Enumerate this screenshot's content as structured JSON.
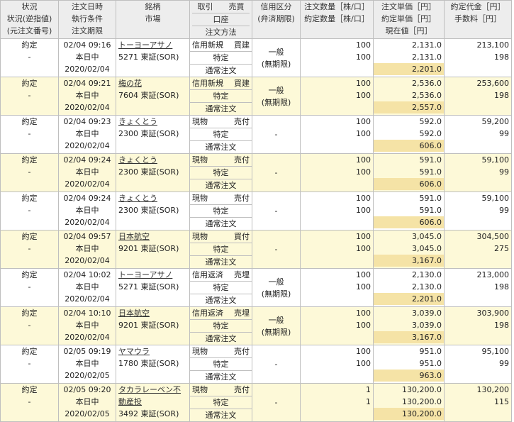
{
  "header": {
    "status": [
      "状況",
      "状況(逆指値)",
      "(元注文番号)"
    ],
    "datetime": [
      "注文日時",
      "執行条件",
      "注文期限"
    ],
    "symbol": [
      "銘柄",
      "市場"
    ],
    "trade": [
      "取引　　売買",
      "口座",
      "注文方法"
    ],
    "credit": [
      "信用区分",
      "(弁済期限)"
    ],
    "qty": [
      "注文数量［株/口］",
      "約定数量［株/口］"
    ],
    "price": [
      "注文単価［円］",
      "約定単価［円］",
      "現在値［円］"
    ],
    "amount": [
      "約定代金［円］",
      "手数料［円］"
    ]
  },
  "rows": [
    {
      "status": "約定",
      "sub": "-",
      "datetime": "02/04  09:16",
      "cond": "本日中",
      "limit": "2020/02/04",
      "name": "トーヨーアサノ",
      "code": "5271 東証(SOR)",
      "trade": "信用新規",
      "side": "買建",
      "account": "特定",
      "method": "通常注文",
      "credit": "一般",
      "credit_term": "(無期限)",
      "qty": "100",
      "filled": "100",
      "order_price": "2,131.0",
      "fill_price": "2,131.0",
      "current": "2,201.0",
      "amount": "213,100",
      "fee": "198"
    },
    {
      "status": "約定",
      "sub": "-",
      "datetime": "02/04  09:21",
      "cond": "本日中",
      "limit": "2020/02/04",
      "name": "梅の花",
      "code": "7604 東証(SOR)",
      "trade": "信用新規",
      "side": "買建",
      "account": "特定",
      "method": "通常注文",
      "credit": "一般",
      "credit_term": "(無期限)",
      "qty": "100",
      "filled": "100",
      "order_price": "2,536.0",
      "fill_price": "2,536.0",
      "current": "2,557.0",
      "amount": "253,600",
      "fee": "198"
    },
    {
      "status": "約定",
      "sub": "-",
      "datetime": "02/04  09:23",
      "cond": "本日中",
      "limit": "2020/02/04",
      "name": "きょくとう",
      "code": "2300 東証(SOR)",
      "trade": "現物",
      "side": "売付",
      "account": "特定",
      "method": "通常注文",
      "credit": "-",
      "credit_term": "",
      "qty": "100",
      "filled": "100",
      "order_price": "592.0",
      "fill_price": "592.0",
      "current": "606.0",
      "amount": "59,200",
      "fee": "99"
    },
    {
      "status": "約定",
      "sub": "-",
      "datetime": "02/04  09:24",
      "cond": "本日中",
      "limit": "2020/02/04",
      "name": "きょくとう",
      "code": "2300 東証(SOR)",
      "trade": "現物",
      "side": "売付",
      "account": "特定",
      "method": "通常注文",
      "credit": "-",
      "credit_term": "",
      "qty": "100",
      "filled": "100",
      "order_price": "591.0",
      "fill_price": "591.0",
      "current": "606.0",
      "amount": "59,100",
      "fee": "99"
    },
    {
      "status": "約定",
      "sub": "-",
      "datetime": "02/04  09:24",
      "cond": "本日中",
      "limit": "2020/02/04",
      "name": "きょくとう",
      "code": "2300 東証(SOR)",
      "trade": "現物",
      "side": "売付",
      "account": "特定",
      "method": "通常注文",
      "credit": "-",
      "credit_term": "",
      "qty": "100",
      "filled": "100",
      "order_price": "591.0",
      "fill_price": "591.0",
      "current": "606.0",
      "amount": "59,100",
      "fee": "99"
    },
    {
      "status": "約定",
      "sub": "-",
      "datetime": "02/04  09:57",
      "cond": "本日中",
      "limit": "2020/02/04",
      "name": "日本航空",
      "code": "9201 東証(SOR)",
      "trade": "現物",
      "side": "買付",
      "account": "特定",
      "method": "通常注文",
      "credit": "-",
      "credit_term": "",
      "qty": "100",
      "filled": "100",
      "order_price": "3,045.0",
      "fill_price": "3,045.0",
      "current": "3,167.0",
      "amount": "304,500",
      "fee": "275"
    },
    {
      "status": "約定",
      "sub": "-",
      "datetime": "02/04  10:02",
      "cond": "本日中",
      "limit": "2020/02/04",
      "name": "トーヨーアサノ",
      "code": "5271 東証(SOR)",
      "trade": "信用返済",
      "side": "売埋",
      "account": "特定",
      "method": "通常注文",
      "credit": "一般",
      "credit_term": "(無期限)",
      "qty": "100",
      "filled": "100",
      "order_price": "2,130.0",
      "fill_price": "2,130.0",
      "current": "2,201.0",
      "amount": "213,000",
      "fee": "198"
    },
    {
      "status": "約定",
      "sub": "-",
      "datetime": "02/04  10:10",
      "cond": "本日中",
      "limit": "2020/02/04",
      "name": "日本航空",
      "code": "9201 東証(SOR)",
      "trade": "信用返済",
      "side": "売埋",
      "account": "特定",
      "method": "通常注文",
      "credit": "一般",
      "credit_term": "(無期限)",
      "qty": "100",
      "filled": "100",
      "order_price": "3,039.0",
      "fill_price": "3,039.0",
      "current": "3,167.0",
      "amount": "303,900",
      "fee": "198"
    },
    {
      "status": "約定",
      "sub": "-",
      "datetime": "02/05  09:19",
      "cond": "本日中",
      "limit": "2020/02/05",
      "name": "ヤマウラ",
      "code": "1780 東証(SOR)",
      "trade": "現物",
      "side": "売付",
      "account": "特定",
      "method": "通常注文",
      "credit": "-",
      "credit_term": "",
      "qty": "100",
      "filled": "100",
      "order_price": "951.0",
      "fill_price": "951.0",
      "current": "963.0",
      "amount": "95,100",
      "fee": "99"
    },
    {
      "status": "約定",
      "sub": "-",
      "datetime": "02/05  09:20",
      "cond": "本日中",
      "limit": "2020/02/05",
      "name": "タカラレーベン不動産投",
      "code": "3492 東証(SOR)",
      "trade": "現物",
      "side": "売付",
      "account": "特定",
      "method": "通常注文",
      "credit": "-",
      "credit_term": "",
      "qty": "1",
      "filled": "1",
      "order_price": "130,200.0",
      "fill_price": "130,200.0",
      "current": "130,200.0",
      "amount": "130,200",
      "fee": "115"
    }
  ]
}
